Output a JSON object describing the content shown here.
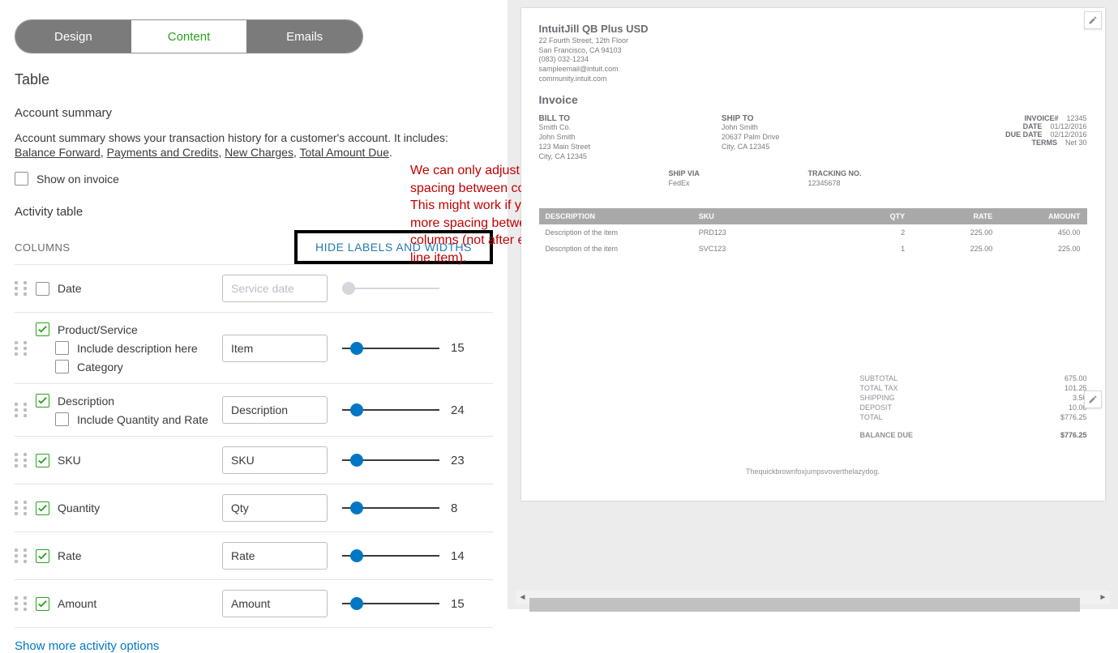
{
  "tabs": {
    "design": "Design",
    "content": "Content",
    "emails": "Emails",
    "active": "content"
  },
  "table_heading": "Table",
  "account_summary": {
    "heading": "Account summary",
    "desc_prefix": "Account summary shows your transaction history for a customer's account. It includes:",
    "links": [
      "Balance Forward",
      "Payments and Credits",
      "New Charges",
      "Total Amount Due"
    ],
    "show_on_invoice_label": "Show on invoice",
    "show_on_invoice_checked": false
  },
  "activity_heading": "Activity table",
  "columns_label": "COLUMNS",
  "hide_button": "HIDE LABELS AND WIDTHS",
  "columns": [
    {
      "id": "date",
      "label": "Date",
      "checked": false,
      "input": "Service date",
      "input_disabled": true,
      "slider": null
    },
    {
      "id": "product",
      "label": "Product/Service",
      "checked": true,
      "subs": [
        {
          "label": "Include description here",
          "checked": false
        },
        {
          "label": "Category",
          "checked": false
        }
      ],
      "input": "Item",
      "slider": 15
    },
    {
      "id": "description",
      "label": "Description",
      "checked": true,
      "subs": [
        {
          "label": "Include Quantity and Rate",
          "checked": false
        }
      ],
      "input": "Description",
      "slider": 24
    },
    {
      "id": "sku",
      "label": "SKU",
      "checked": true,
      "input": "SKU",
      "slider": 23
    },
    {
      "id": "quantity",
      "label": "Quantity",
      "checked": true,
      "input": "Qty",
      "slider": 8
    },
    {
      "id": "rate",
      "label": "Rate",
      "checked": true,
      "input": "Rate",
      "slider": 14
    },
    {
      "id": "amount",
      "label": "Amount",
      "checked": true,
      "input": "Amount",
      "slider": 15
    }
  ],
  "show_more": "Show more activity options",
  "annotation": "We can only adjust the spacing between columns. This might work if you need more spacing between columns (not after every line item).",
  "preview": {
    "company": "IntuitJill QB Plus USD",
    "addr1": "22 Fourth Street, 12th Floor",
    "addr2": "San Francisco, CA 94103",
    "phone": "(083) 032-1234",
    "email": "sampleemail@intuit.com",
    "web": "community.intuit.com",
    "doc_title": "Invoice",
    "bill_to_label": "BILL TO",
    "bill_to": [
      "Smith Co.",
      "John Smith",
      "123 Main Street",
      "City, CA 12345"
    ],
    "ship_to_label": "SHIP TO",
    "ship_to": [
      "John Smith",
      "20637 Palm Drive",
      "City, CA 12345"
    ],
    "meta": [
      [
        "INVOICE#",
        "12345"
      ],
      [
        "DATE",
        "01/12/2016"
      ],
      [
        "DUE DATE",
        "02/12/2016"
      ],
      [
        "TERMS",
        "Net 30"
      ]
    ],
    "ship_via_label": "SHIP VIA",
    "ship_via": "FedEx",
    "tracking_label": "TRACKING NO.",
    "tracking": "12345678",
    "table_headers": [
      "DESCRIPTION",
      "SKU",
      "QTY",
      "RATE",
      "AMOUNT"
    ],
    "rows": [
      [
        "Description of the item",
        "PRD123",
        "2",
        "225.00",
        "450.00"
      ],
      [
        "Description of the item",
        "SVC123",
        "1",
        "225.00",
        "225.00"
      ]
    ],
    "totals": [
      [
        "SUBTOTAL",
        "675.00"
      ],
      [
        "TOTAL TAX",
        "101.25"
      ],
      [
        "SHIPPING",
        "3.50"
      ],
      [
        "DEPOSIT",
        "10.00"
      ],
      [
        "TOTAL",
        "$776.25"
      ]
    ],
    "balance_due_label": "BALANCE DUE",
    "balance_due": "$776.25",
    "footer": "Thequickbrownfoxjumpsvoverthelazydog."
  }
}
